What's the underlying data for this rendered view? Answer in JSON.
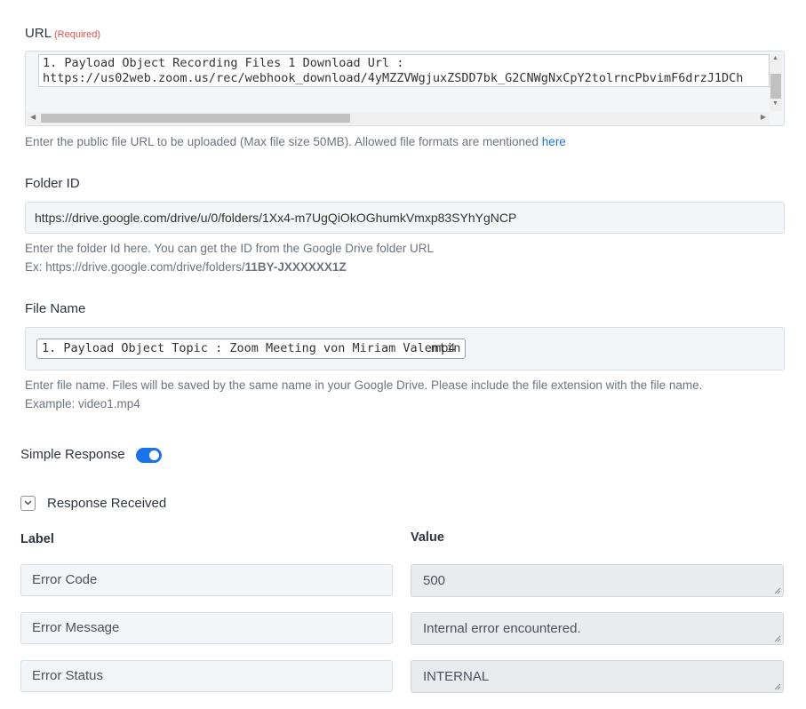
{
  "url_field": {
    "label": "URL",
    "required": "(Required)",
    "line1": "1. Payload Object Recording Files 1 Download Url :",
    "line2": "https://us02web.zoom.us/rec/webhook_download/4yMZZVWgjuxZSDD7bk_G2CNWgNxCpY2tolrncPbvimF6drzJ1DCh",
    "help": "Enter the public file URL to be uploaded (Max file size 50MB). Allowed file formats are mentioned ",
    "help_link": "here"
  },
  "folder_field": {
    "label": "Folder ID",
    "value": "https://drive.google.com/drive/u/0/folders/1Xx4-m7UgQiOkOGhumkVmxp83SYhYgNCP",
    "help_line1": "Enter the folder Id here. You can get the ID from the Google Drive folder URL",
    "help_line2_prefix": "Ex: https://drive.google.com/drive/folders/",
    "help_line2_bold": "11BY-JXXXXXX1Z"
  },
  "file_name_field": {
    "label": "File Name",
    "chip": "1. Payload Object Topic : Zoom Meeting von Miriam Valentin",
    "extension": ".mp4",
    "help_line1": "Enter file name. Files will be saved by the same name in your Google Drive. Please include the file extension with the file name.",
    "help_line2": "Example: video1.mp4"
  },
  "simple_response": {
    "label": "Simple Response",
    "enabled": true
  },
  "response_received": {
    "label": "Response Received",
    "label_header": "Label",
    "value_header": "Value",
    "rows": [
      {
        "label": "Error Code",
        "value": "500"
      },
      {
        "label": "Error Message",
        "value": "Internal error encountered."
      },
      {
        "label": "Error Status",
        "value": "INTERNAL"
      }
    ]
  },
  "colors": {
    "accent": "#1a73e8",
    "required": "#d9534f",
    "link": "#1a73d0"
  }
}
